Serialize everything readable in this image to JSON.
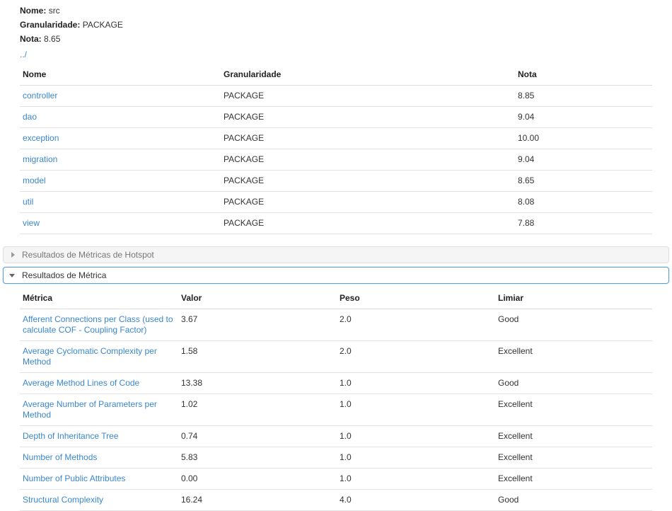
{
  "summary": {
    "fields": [
      {
        "label": "Nome:",
        "value": "src"
      },
      {
        "label": "Granularidade:",
        "value": "PACKAGE"
      },
      {
        "label": "Nota:",
        "value": "8.65"
      }
    ],
    "parent_link": "../"
  },
  "files_table": {
    "columns": [
      "Nome",
      "Granularidade",
      "Nota"
    ],
    "rows": [
      {
        "nome": "controller",
        "granularidade": "PACKAGE",
        "nota": "8.85"
      },
      {
        "nome": "dao",
        "granularidade": "PACKAGE",
        "nota": "9.04"
      },
      {
        "nome": "exception",
        "granularidade": "PACKAGE",
        "nota": "10.00"
      },
      {
        "nome": "migration",
        "granularidade": "PACKAGE",
        "nota": "9.04"
      },
      {
        "nome": "model",
        "granularidade": "PACKAGE",
        "nota": "8.65"
      },
      {
        "nome": "util",
        "granularidade": "PACKAGE",
        "nota": "8.08"
      },
      {
        "nome": "view",
        "granularidade": "PACKAGE",
        "nota": "7.88"
      }
    ]
  },
  "accordion": {
    "hotspot_panel": {
      "title": "Resultados de Métricas de Hotspot",
      "state": "collapsed",
      "icon": "triangle-right-icon"
    },
    "metric_panel": {
      "title": "Resultados de Métrica",
      "state": "expanded",
      "icon": "triangle-down-icon"
    }
  },
  "metrics_table": {
    "columns": [
      "Métrica",
      "Valor",
      "Peso",
      "Limiar"
    ],
    "rows": [
      {
        "metrica": "Afferent Connections per Class (used to calculate COF - Coupling Factor)",
        "valor": "3.67",
        "peso": "2.0",
        "limiar": "Good",
        "limiar_class": "good"
      },
      {
        "metrica": "Average Cyclomatic Complexity per Method",
        "valor": "1.58",
        "peso": "2.0",
        "limiar": "Excellent",
        "limiar_class": "excellent"
      },
      {
        "metrica": "Average Method Lines of Code",
        "valor": "13.38",
        "peso": "1.0",
        "limiar": "Good",
        "limiar_class": "good"
      },
      {
        "metrica": "Average Number of Parameters per Method",
        "valor": "1.02",
        "peso": "1.0",
        "limiar": "Excellent",
        "limiar_class": "excellent"
      },
      {
        "metrica": "Depth of Inheritance Tree",
        "valor": "0.74",
        "peso": "1.0",
        "limiar": "Excellent",
        "limiar_class": "excellent"
      },
      {
        "metrica": "Number of Methods",
        "valor": "5.83",
        "peso": "1.0",
        "limiar": "Excellent",
        "limiar_class": "excellent"
      },
      {
        "metrica": "Number of Public Attributes",
        "valor": "0.00",
        "peso": "1.0",
        "limiar": "Excellent",
        "limiar_class": "excellent"
      },
      {
        "metrica": "Structural Complexity",
        "valor": "16.24",
        "peso": "4.0",
        "limiar": "Good",
        "limiar_class": "good"
      }
    ]
  },
  "colors": {
    "link": "#3a87cd",
    "good": "#9aff1a",
    "excellent": "#00ee00",
    "panel_focus_border": "#5b9dd9",
    "panel_collapsed_bg": "#f5f5f5",
    "row_divider": "#e2e2e2"
  }
}
